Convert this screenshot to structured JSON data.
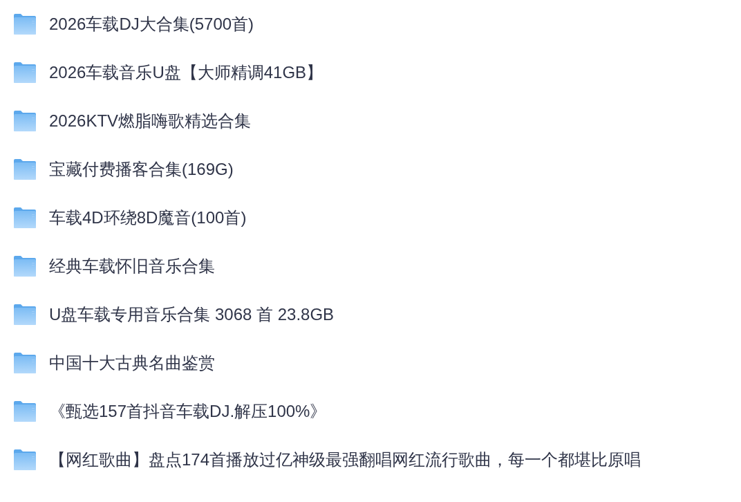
{
  "folders": [
    {
      "name": "2026车载DJ大合集(5700首)"
    },
    {
      "name": "2026车载音乐U盘【大师精调41GB】"
    },
    {
      "name": "2026KTV燃脂嗨歌精选合集"
    },
    {
      "name": "宝藏付费播客合集(169G)"
    },
    {
      "name": "车载4D环绕8D魔音(100首)"
    },
    {
      "name": "经典车载怀旧音乐合集"
    },
    {
      "name": "U盘车载专用音乐合集 3068 首 23.8GB"
    },
    {
      "name": "中国十大古典名曲鉴赏"
    },
    {
      "name": "《甄选157首抖音车载DJ.解压100%》"
    },
    {
      "name": "【网红歌曲】盘点174首播放过亿神级最强翻唱网红流行歌曲，每一个都堪比原唱"
    }
  ]
}
